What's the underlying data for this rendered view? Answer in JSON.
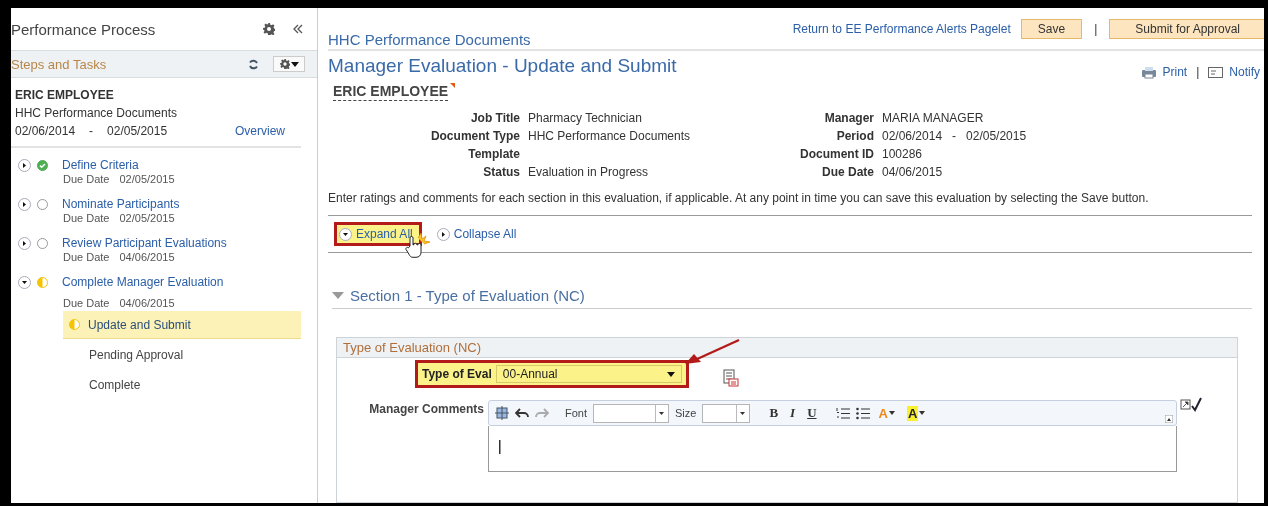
{
  "sidebar": {
    "title": "Performance Process",
    "section_title": "Steps and Tasks",
    "employee": {
      "name": "ERIC EMPLOYEE",
      "document": "HHC Performance Documents",
      "period_start": "02/06/2014",
      "period_sep": "-",
      "period_end": "02/05/2015",
      "link": "Overview"
    },
    "steps": [
      {
        "label": "Define Criteria",
        "due_label": "Due Date",
        "due": "02/05/2015",
        "kind": "complete",
        "expanded": false
      },
      {
        "label": "Nominate Participants",
        "due_label": "Due Date",
        "due": "02/05/2015",
        "kind": "pending",
        "expanded": false
      },
      {
        "label": "Review Participant Evaluations",
        "due_label": "Due Date",
        "due": "04/06/2015",
        "kind": "pending",
        "expanded": false
      },
      {
        "label": "Complete Manager Evaluation",
        "due_label": "Due Date",
        "due": "04/06/2015",
        "kind": "partial",
        "expanded": true,
        "children": [
          {
            "label": "Update and Submit",
            "kind": "partial",
            "selected": true
          },
          {
            "label": "Pending Approval",
            "selected": false
          },
          {
            "label": "Complete",
            "selected": false
          }
        ]
      }
    ]
  },
  "header": {
    "breadcrumb": "HHC Performance Documents",
    "return_link": "Return to EE Performance Alerts Pagelet",
    "save": "Save",
    "separator": "|",
    "submit": "Submit for Approval"
  },
  "page": {
    "title": "Manager Evaluation - Update and Submit",
    "print": "Print",
    "action_sep": "|",
    "notify": "Notify",
    "employee": "ERIC EMPLOYEE"
  },
  "details": [
    {
      "label": "Job Title",
      "value": "Pharmacy Technician"
    },
    {
      "label": "Manager",
      "value": "MARIA MANAGER"
    },
    {
      "label": "Document Type",
      "value": "HHC Performance Documents"
    },
    {
      "label": "Period",
      "value": "02/06/2014",
      "sep": "-",
      "value2": "02/05/2015"
    },
    {
      "label": "Template"
    },
    {
      "label": "Document ID",
      "value": "100286"
    },
    {
      "label": "Status",
      "value": "Evaluation in Progress"
    },
    {
      "label": "Due Date",
      "value": "04/06/2015"
    }
  ],
  "instructions": "Enter ratings and comments for each section in this evaluation, if applicable. At any point in time you can save this evaluation by selecting the Save button.",
  "expand_all": {
    "label": "Expand All",
    "highlighted": true
  },
  "collapse_all": {
    "label": "Collapse All",
    "highlighted": false
  },
  "section": {
    "title": "Section 1 - Type of Evaluation (NC)",
    "expanded": true,
    "group_title": "Type of Evaluation (NC)",
    "type_field": {
      "label": "Type of Eval",
      "value": "00-Annual",
      "highlighted": true
    },
    "comments": {
      "label": "Manager Comments",
      "font_label": "Font",
      "size_label": "Size",
      "bold": "B",
      "italic": "I",
      "underline": "U",
      "text_color": "A",
      "bg_color": "A"
    }
  }
}
